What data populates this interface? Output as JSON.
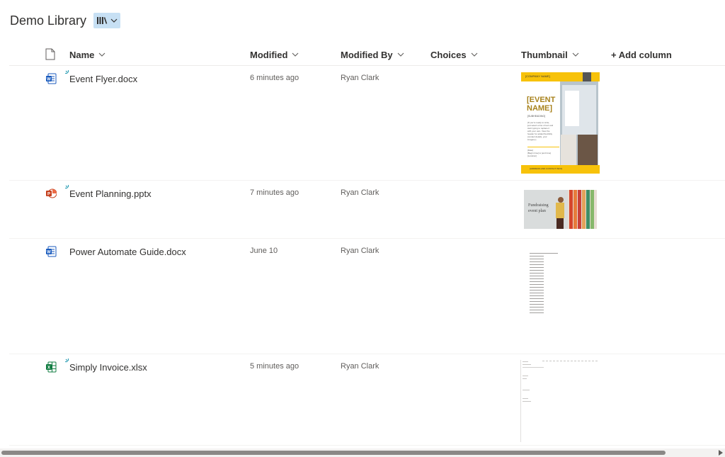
{
  "library": {
    "title": "Demo Library"
  },
  "icons": {
    "view": "library-icon",
    "doc_header": "document-icon",
    "word": "word-file-icon",
    "powerpoint": "powerpoint-file-icon",
    "excel": "excel-file-icon"
  },
  "colors": {
    "accent_light": "#c7e0f4",
    "word_blue": "#185abd",
    "ppt_red": "#c43e1c",
    "excel_green": "#107c41",
    "new_mark": "#36a2b8",
    "flyer_yellow": "#f7c20a"
  },
  "columns": {
    "name": "Name",
    "modified": "Modified",
    "modified_by": "Modified By",
    "choices": "Choices",
    "thumbnail": "Thumbnail",
    "add_column": "+ Add column"
  },
  "rows": [
    {
      "name": "Event Flyer.docx",
      "modified": "6 minutes ago",
      "modified_by": "Ryan Clark",
      "type": "word",
      "is_new": true
    },
    {
      "name": "Event Planning.pptx",
      "modified": "7 minutes ago",
      "modified_by": "Ryan Clark",
      "type": "powerpoint",
      "is_new": true
    },
    {
      "name": "Power Automate Guide.docx",
      "modified": "June 10",
      "modified_by": "Ryan Clark",
      "type": "word",
      "is_new": false
    },
    {
      "name": "Simply Invoice.xlsx",
      "modified": "5 minutes ago",
      "modified_by": "Ryan Clark",
      "type": "excel",
      "is_new": true
    }
  ],
  "thumbnails": {
    "flyer": {
      "header_text": "[COMPANY NAME]",
      "event_title": "[EVENT NAME]",
      "subtitle": "[SUBHEADING]",
      "body_lines": [
        "[If you're ready to write,",
        "just select a line of text and",
        "start typing to replace it",
        "with your own. View the",
        "header for added flexibility",
        "(contact details, your",
        "images).]"
      ],
      "date_label": "[Date]",
      "time_label": "[Begin time] to [end time]",
      "location": "[Location]",
      "footer_text": "[ADDRESS AND CONTACT INFO]"
    },
    "slide": {
      "title_line1": "Fundraising",
      "title_line2": "event plan"
    }
  }
}
